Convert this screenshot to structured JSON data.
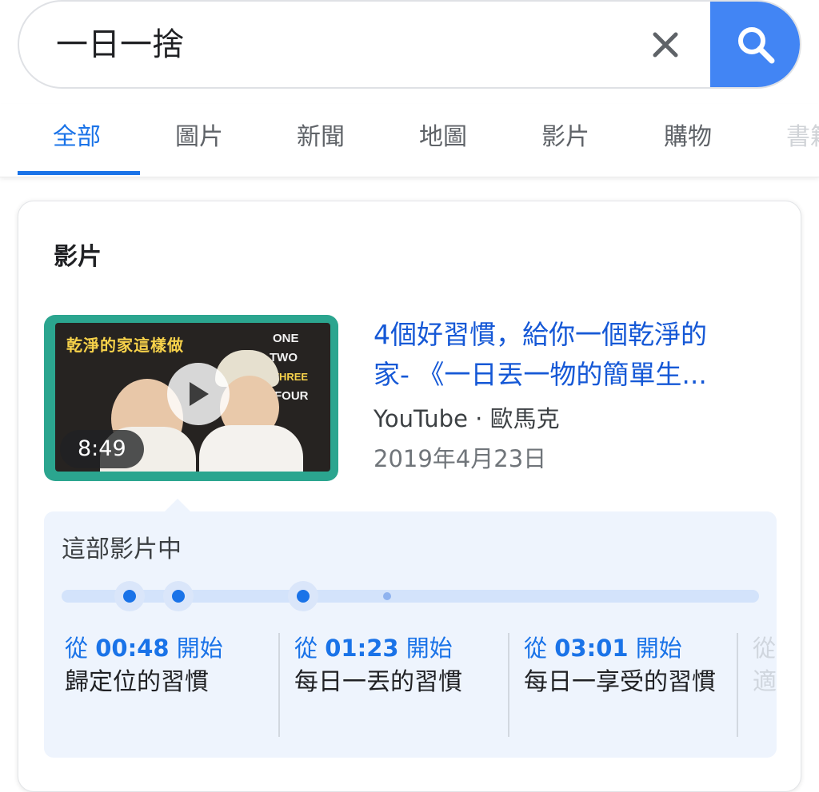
{
  "search": {
    "query": "一日一捨",
    "clear_icon": "close-icon",
    "search_icon": "search-icon",
    "accent_color": "#4285f4"
  },
  "tabs": [
    {
      "label": "全部",
      "active": true
    },
    {
      "label": "圖片",
      "active": false
    },
    {
      "label": "新聞",
      "active": false
    },
    {
      "label": "地圖",
      "active": false
    },
    {
      "label": "影片",
      "active": false
    },
    {
      "label": "購物",
      "active": false
    },
    {
      "label": "書籍",
      "active": false
    }
  ],
  "video_card": {
    "heading": "影片",
    "thumbnail": {
      "caption": "乾淨的家這樣做",
      "sign_lines": [
        "ONE",
        "TWO",
        "THREE",
        "FOUR"
      ],
      "duration": "8:49",
      "play_icon": "play-icon"
    },
    "title_line1": "4個好習慣，給你一個乾淨的",
    "title_line2": "家- 《一日丟一物的簡單生...",
    "source": "YouTube · 歐馬克",
    "date": "2019年4月23日",
    "moments_heading": "這部影片中",
    "moments": [
      {
        "prefix": "從",
        "time": "00:48",
        "suffix": "開始",
        "label": "歸定位的習慣"
      },
      {
        "prefix": "從",
        "time": "01:23",
        "suffix": "開始",
        "label": "每日一丟的習慣"
      },
      {
        "prefix": "從",
        "time": "03:01",
        "suffix": "開始",
        "label": "每日一享受的習慣"
      },
      {
        "prefix": "從",
        "time": "",
        "suffix": "",
        "label": "適"
      }
    ]
  }
}
